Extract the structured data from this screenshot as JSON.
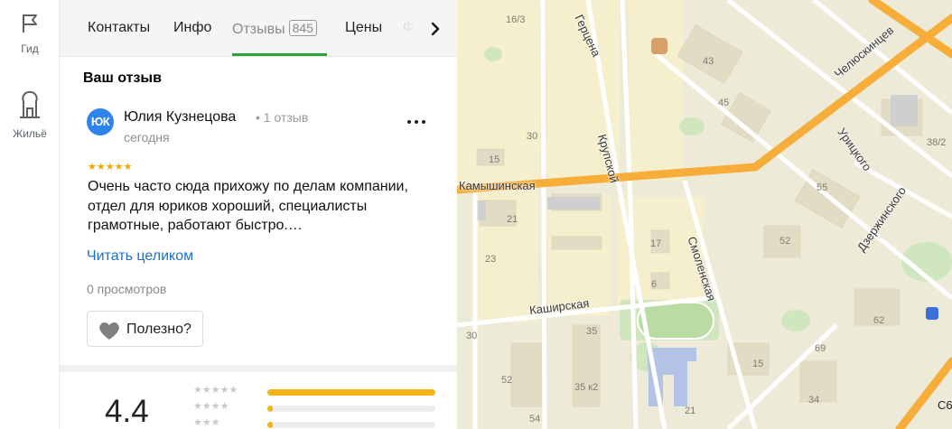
{
  "rail": {
    "items": [
      {
        "label": "Гид",
        "icon": "flag-icon"
      },
      {
        "label": "Жильё",
        "icon": "building-icon"
      }
    ]
  },
  "tabs": {
    "items": [
      {
        "label": "Контакты"
      },
      {
        "label": "Инфо"
      },
      {
        "label": "Отзывы",
        "count": "845",
        "active": true
      },
      {
        "label": "Цены"
      },
      {
        "label": "Ф"
      }
    ]
  },
  "review_section": {
    "title": "Ваш отзыв",
    "avatar_initials": "ЮК",
    "author": "Юлия Кузнецова",
    "author_meta": "• 1 отзыв",
    "date": "сегодня",
    "rating_stars": "★★★★★",
    "rating": 5,
    "text": "Очень часто сюда прихожу по делам компании, отдел для юриков хороший, специалисты грамотные, работают быстро.…",
    "read_more": "Читать целиком",
    "views": "0 просмотров",
    "useful_label": "Полезно?"
  },
  "rating_summary": {
    "value": "4.4",
    "rows": [
      {
        "stars": "★★★★★",
        "fraction": 1.0
      },
      {
        "stars": "★★★★",
        "fraction": 0.03
      },
      {
        "stars": "★★★",
        "fraction": 0.03
      }
    ]
  },
  "map": {
    "streets": [
      "Челюскинцев",
      "Герцена",
      "Урицкого",
      "Камышинская",
      "Крупской",
      "Дзержинского",
      "Смоленская",
      "Каширская"
    ],
    "houses": [
      "16/3",
      "43",
      "45",
      "30",
      "38/2",
      "15",
      "55",
      "21",
      "17",
      "52",
      "23",
      "6",
      "62",
      "30",
      "35",
      "69",
      "52",
      "15",
      "35 к2",
      "21",
      "34",
      "54",
      "С6"
    ],
    "colors": {
      "background": "#eeead8",
      "block": "#f6efce",
      "major_road": "#f7ad3a",
      "road": "#ffffff",
      "park": "#cfe6bf",
      "school": "#b3c3e6"
    }
  }
}
